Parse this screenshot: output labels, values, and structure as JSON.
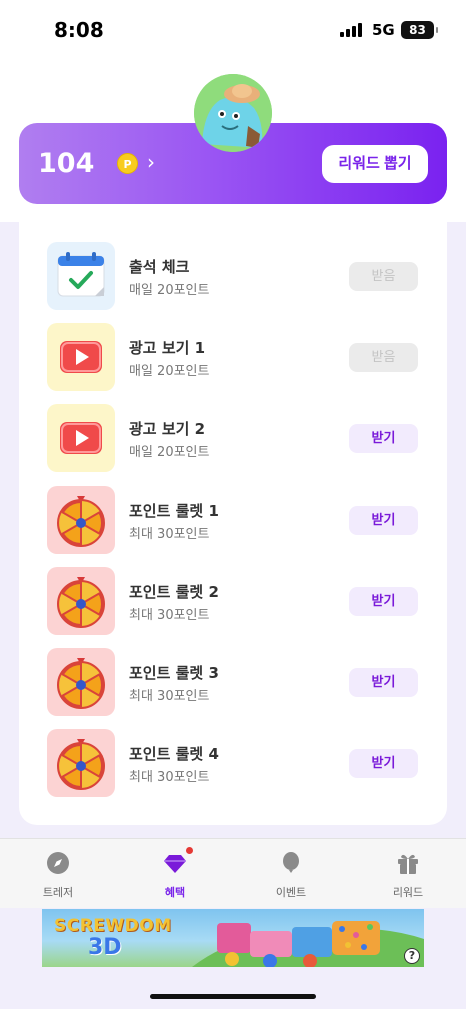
{
  "status_bar": {
    "time": "8:08",
    "network": "5G",
    "battery": "83"
  },
  "points": {
    "value": "104",
    "coin_symbol": "P",
    "reward_button": "리워드 뽑기"
  },
  "tasks": [
    {
      "title": "출석 체크",
      "subtitle": "매일 20포인트",
      "button": "받음",
      "state": "done",
      "icon": "calendar-check-icon"
    },
    {
      "title": "광고 보기 1",
      "subtitle": "매일 20포인트",
      "button": "받음",
      "state": "done",
      "icon": "video-play-icon"
    },
    {
      "title": "광고 보기 2",
      "subtitle": "매일 20포인트",
      "button": "받기",
      "state": "available",
      "icon": "video-play-icon"
    },
    {
      "title": "포인트 룰렛 1",
      "subtitle": "최대 30포인트",
      "button": "받기",
      "state": "available",
      "icon": "roulette-wheel-icon"
    },
    {
      "title": "포인트 룰렛 2",
      "subtitle": "최대 30포인트",
      "button": "받기",
      "state": "available",
      "icon": "roulette-wheel-icon"
    },
    {
      "title": "포인트 룰렛 3",
      "subtitle": "최대 30포인트",
      "button": "받기",
      "state": "available",
      "icon": "roulette-wheel-icon"
    },
    {
      "title": "포인트 룰렛 4",
      "subtitle": "최대 30포인트",
      "button": "받기",
      "state": "available",
      "icon": "roulette-wheel-icon"
    }
  ],
  "tabs": [
    {
      "label": "트레저",
      "icon": "compass-icon",
      "active": false
    },
    {
      "label": "혜택",
      "icon": "diamond-icon",
      "active": true,
      "badge": true
    },
    {
      "label": "이벤트",
      "icon": "balloon-icon",
      "active": false
    },
    {
      "label": "리워드",
      "icon": "gift-icon",
      "active": false
    }
  ],
  "ad": {
    "title": "SCREWDOM",
    "subtitle": "3D",
    "help": "?"
  },
  "colors": {
    "accent": "#7a24ea",
    "done_bg": "#ebebeb",
    "get_bg": "#f2ebfd",
    "badge": "#e53935"
  }
}
